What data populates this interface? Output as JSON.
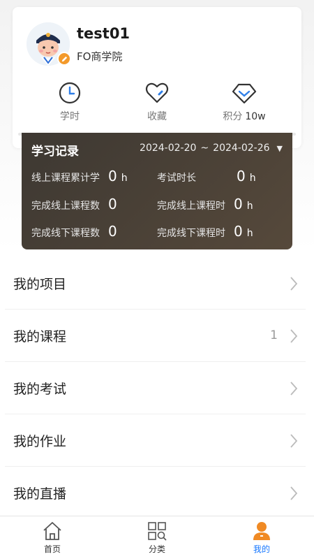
{
  "profile": {
    "username": "test01",
    "organization": "FO商学院"
  },
  "stats": [
    {
      "label": "学时",
      "value": "",
      "icon": "clock-icon"
    },
    {
      "label": "收藏",
      "value": "",
      "icon": "heart-icon"
    },
    {
      "label": "积分",
      "value": "10w",
      "icon": "diamond-icon"
    }
  ],
  "record": {
    "title": "学习记录",
    "date_start": "2024-02-20",
    "date_sep": "~",
    "date_end": "2024-02-26",
    "items": [
      {
        "label": "线上课程累计学",
        "value": "0",
        "unit": "h"
      },
      {
        "label": "考试时长",
        "value": "0",
        "unit": "h"
      },
      {
        "label": "完成线上课程数",
        "value": "0",
        "unit": ""
      },
      {
        "label": "完成线上课程时",
        "value": "0",
        "unit": "h"
      },
      {
        "label": "完成线下课程数",
        "value": "0",
        "unit": ""
      },
      {
        "label": "完成线下课程时",
        "value": "0",
        "unit": "h"
      }
    ]
  },
  "menu": [
    {
      "label": "我的项目",
      "count": ""
    },
    {
      "label": "我的课程",
      "count": "1"
    },
    {
      "label": "我的考试",
      "count": ""
    },
    {
      "label": "我的作业",
      "count": ""
    },
    {
      "label": "我的直播",
      "count": ""
    }
  ],
  "tabs": [
    {
      "label": "首页",
      "icon": "home-icon"
    },
    {
      "label": "分类",
      "icon": "category-icon"
    },
    {
      "label": "我的",
      "icon": "profile-icon",
      "active": true
    }
  ],
  "colors": {
    "accent": "#1677ff",
    "badge": "#f39a2b",
    "record_bg": "#4a4038"
  }
}
